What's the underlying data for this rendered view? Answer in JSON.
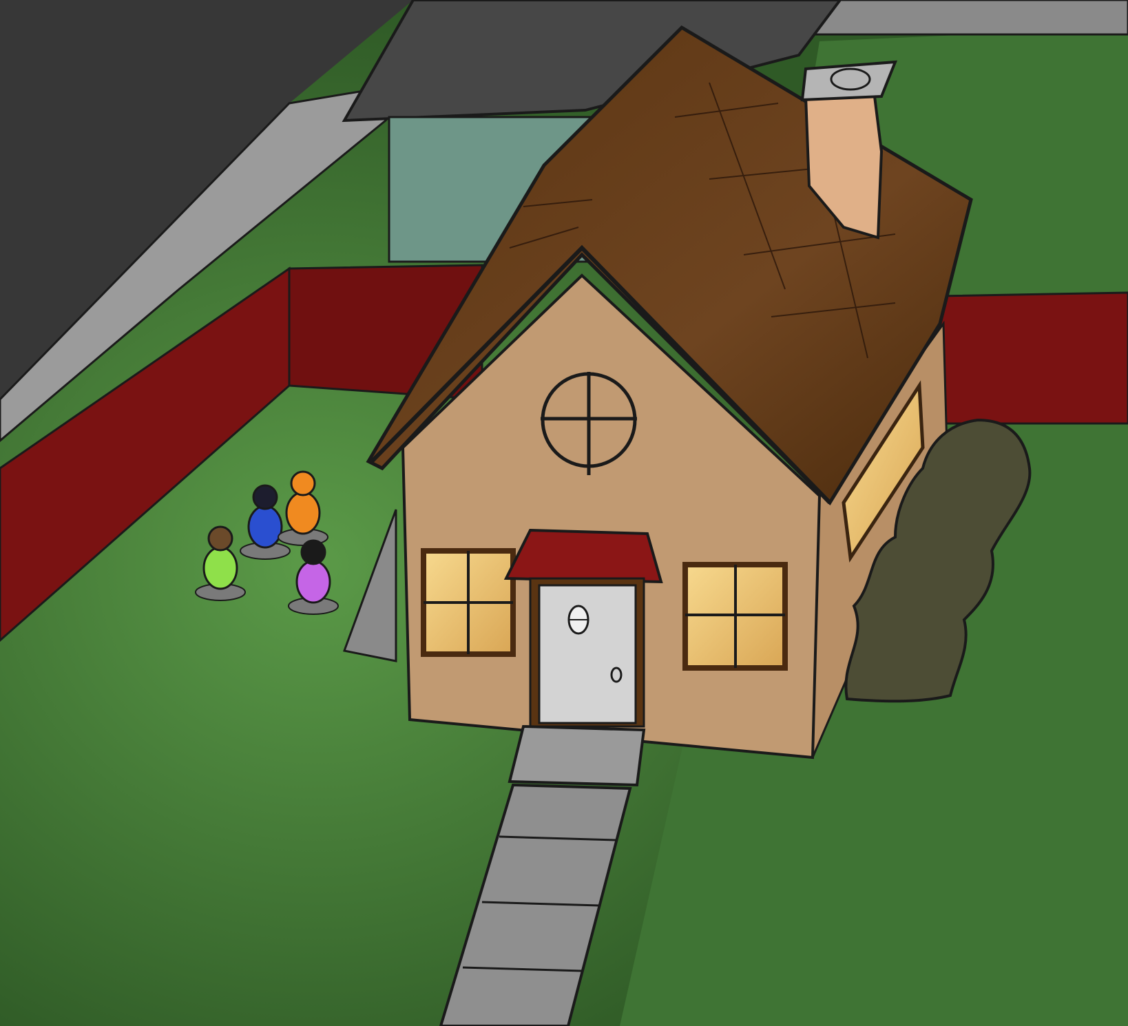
{
  "scene": {
    "kind": "illustration",
    "colors": {
      "grass": "#4a7f3c",
      "grass_dark": "#2c5222",
      "fence": "#7a1212",
      "roof": "#6b3f17",
      "wall": "#c19a72",
      "window_glow": "#f2c77a",
      "door": "#d3d3d3",
      "awning": "#8b1616",
      "asphalt": "#3a3a3a",
      "sidewalk": "#9a9a9a",
      "path": "#8f8f8f",
      "neighbor_wall": "#6e9688",
      "bush": "#4d4d35",
      "chimney": "#e0b088"
    },
    "children": [
      {
        "shirt": "#8fe04a",
        "hair": "#6b4a2a"
      },
      {
        "shirt": "#2a4fd0",
        "hair": "#1d1d2e"
      },
      {
        "shirt": "#f08a20",
        "hair": "#f08a20"
      },
      {
        "shirt": "#c565e6",
        "hair": "#1a1a1a"
      }
    ]
  }
}
